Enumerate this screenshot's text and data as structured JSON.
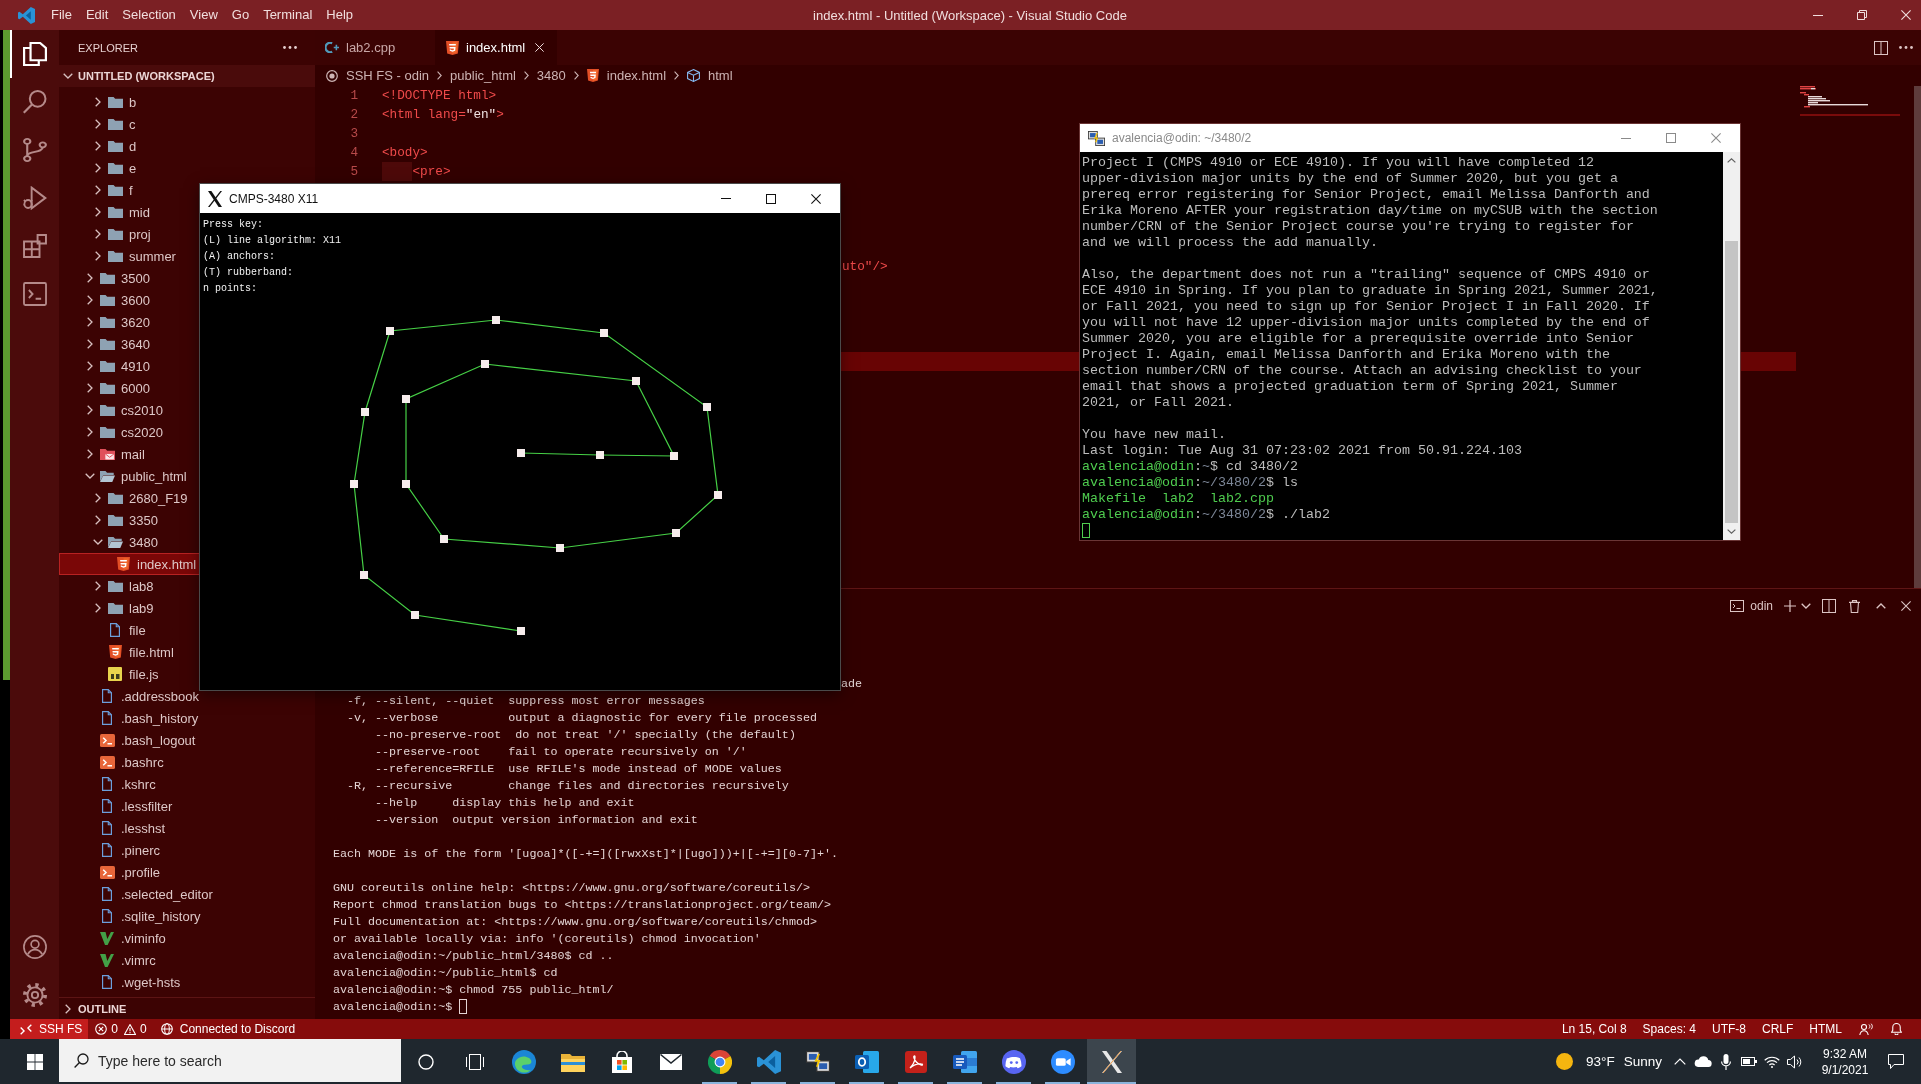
{
  "title_bar": {
    "menus": [
      "File",
      "Edit",
      "Selection",
      "View",
      "Go",
      "Terminal",
      "Help"
    ],
    "title": "index.html - Untitled (Workspace) - Visual Studio Code"
  },
  "activity_bar": {
    "items": [
      {
        "kind": "explorer",
        "selected": true
      },
      {
        "kind": "search",
        "selected": false
      },
      {
        "kind": "source-control",
        "selected": false
      },
      {
        "kind": "run",
        "selected": false
      },
      {
        "kind": "extensions",
        "selected": false
      },
      {
        "kind": "remote",
        "selected": false
      }
    ],
    "bottom_items": [
      {
        "kind": "account"
      },
      {
        "kind": "settings"
      }
    ]
  },
  "sidebar": {
    "title": "EXPLORER",
    "workspace": {
      "label": "UNTITLED (WORKSPACE)",
      "expanded": true
    },
    "tree": [
      {
        "children": [
          {
            "label": "b",
            "kind": "folder",
            "expanded": false,
            "selected": false
          },
          {
            "label": "c",
            "kind": "folder",
            "expanded": false,
            "selected": false
          },
          {
            "label": "d",
            "kind": "folder",
            "expanded": false,
            "selected": false
          },
          {
            "label": "e",
            "kind": "folder",
            "expanded": false,
            "selected": false
          },
          {
            "label": "f",
            "kind": "folder",
            "expanded": false,
            "selected": false
          },
          {
            "label": "mid",
            "kind": "folder",
            "expanded": false,
            "selected": false
          },
          {
            "label": "proj",
            "kind": "folder",
            "expanded": false,
            "selected": false
          },
          {
            "label": "summer",
            "kind": "folder",
            "expanded": false,
            "selected": false
          }
        ]
      },
      {
        "label": "3500",
        "kind": "folder",
        "expanded": false,
        "selected": false
      },
      {
        "label": "3600",
        "kind": "folder",
        "expanded": false,
        "selected": false
      },
      {
        "label": "3620",
        "kind": "folder",
        "expanded": false,
        "selected": false
      },
      {
        "label": "3640",
        "kind": "folder",
        "expanded": false,
        "selected": false
      },
      {
        "label": "4910",
        "kind": "folder",
        "expanded": false,
        "selected": false
      },
      {
        "label": "6000",
        "kind": "folder",
        "expanded": false,
        "selected": false
      },
      {
        "label": "cs2010",
        "kind": "folder",
        "expanded": false,
        "selected": false
      },
      {
        "label": "cs2020",
        "kind": "folder",
        "expanded": false,
        "selected": false
      },
      {
        "label": "mail",
        "kind": "mail-folder",
        "expanded": false,
        "selected": false
      },
      {
        "label": "public_html",
        "kind": "folder",
        "expanded": true,
        "selected": false,
        "children": [
          {
            "label": "2680_F19",
            "kind": "folder",
            "expanded": false,
            "selected": false
          },
          {
            "label": "3350",
            "kind": "folder",
            "expanded": false,
            "selected": false
          },
          {
            "label": "3480",
            "kind": "folder",
            "expanded": true,
            "selected": false,
            "children": [
              {
                "label": "index.html",
                "kind": "html",
                "selected": true
              }
            ]
          },
          {
            "label": "lab8",
            "kind": "folder",
            "expanded": false,
            "selected": false
          },
          {
            "label": "lab9",
            "kind": "folder",
            "expanded": false,
            "selected": false
          },
          {
            "label": "file",
            "kind": "file",
            "selected": false
          },
          {
            "label": "file.html",
            "kind": "html",
            "selected": false
          },
          {
            "label": "file.js",
            "kind": "js",
            "selected": false
          }
        ]
      },
      {
        "label": ".addressbook",
        "kind": "file",
        "selected": false
      },
      {
        "label": ".bash_history",
        "kind": "file",
        "selected": false
      },
      {
        "label": ".bash_logout",
        "kind": "shell",
        "selected": false
      },
      {
        "label": ".bashrc",
        "kind": "shell",
        "selected": false
      },
      {
        "label": ".kshrc",
        "kind": "file",
        "selected": false
      },
      {
        "label": ".lessfilter",
        "kind": "file",
        "selected": false
      },
      {
        "label": ".lesshst",
        "kind": "file",
        "selected": false
      },
      {
        "label": ".pinerc",
        "kind": "file",
        "selected": false
      },
      {
        "label": ".profile",
        "kind": "shell",
        "selected": false
      },
      {
        "label": ".selected_editor",
        "kind": "file",
        "selected": false
      },
      {
        "label": ".sqlite_history",
        "kind": "file",
        "selected": false
      },
      {
        "label": ".viminfo",
        "kind": "vim",
        "selected": false
      },
      {
        "label": ".vimrc",
        "kind": "vim",
        "selected": false
      },
      {
        "label": ".wget-hsts",
        "kind": "file",
        "selected": false
      }
    ],
    "outline": {
      "label": "OUTLINE",
      "expanded": false
    }
  },
  "editor": {
    "tabs": [
      {
        "label": "lab2.cpp",
        "kind": "cpp",
        "selected": false
      },
      {
        "label": "index.html",
        "kind": "html",
        "selected": true
      }
    ],
    "breadcrumbs": [
      {
        "label": "SSH FS - odin",
        "kind": "remote"
      },
      {
        "label": "public_html",
        "kind": "folder"
      },
      {
        "label": "3480",
        "kind": "folder"
      },
      {
        "label": "index.html",
        "kind": "html"
      },
      {
        "label": "html",
        "kind": "element"
      }
    ],
    "lines": [
      {
        "number": "1",
        "segments": [
          {
            "kind": "tag",
            "text": "<!DOCTYPE html>"
          }
        ]
      },
      {
        "number": "2",
        "segments": [
          {
            "kind": "tag",
            "text": "<html lang="
          },
          {
            "kind": "string",
            "text": "\"en\""
          },
          {
            "kind": "tag",
            "text": ">"
          }
        ]
      },
      {
        "number": "3"
      },
      {
        "number": "4",
        "segments": [
          {
            "kind": "tag",
            "text": "<body>"
          }
        ]
      },
      {
        "number": "5",
        "indented": true,
        "segments": [
          {
            "kind": "tag",
            "text": "<pre>"
          }
        ]
      }
    ],
    "covered_fragments": [
      {
        "segments": [
          {
            "kind": "tag",
            "text": "uto\"/>"
          }
        ]
      }
    ],
    "current_line_highlight": true
  },
  "panel": {
    "terminal_name": "odin",
    "lines": [
      {
        "kind": "covered",
        "text": "ade"
      },
      {
        "kind": "text",
        "text": "  -f, --silent, --quiet  suppress most error messages"
      },
      {
        "kind": "text",
        "text": "  -v, --verbose          output a diagnostic for every file processed"
      },
      {
        "kind": "text",
        "text": "      --no-preserve-root  do not treat '/' specially (the default)"
      },
      {
        "kind": "text",
        "text": "      --preserve-root    fail to operate recursively on '/'"
      },
      {
        "kind": "text",
        "text": "      --reference=RFILE  use RFILE's mode instead of MODE values"
      },
      {
        "kind": "text",
        "text": "  -R, --recursive        change files and directories recursively"
      },
      {
        "kind": "text",
        "text": "      --help     display this help and exit"
      },
      {
        "kind": "text",
        "text": "      --version  output version information and exit"
      },
      {
        "kind": "blank"
      },
      {
        "kind": "text",
        "text": "Each MODE is of the form '[ugoa]*([-+=]([rwxXst]*|[ugo]))+|[-+=][0-7]+'."
      },
      {
        "kind": "blank"
      },
      {
        "kind": "text",
        "text": "GNU coreutils online help: <https://www.gnu.org/software/coreutils/>"
      },
      {
        "kind": "text",
        "text": "Report chmod translation bugs to <https://translationproject.org/team/>"
      },
      {
        "kind": "text",
        "text": "Full documentation at: <https://www.gnu.org/software/coreutils/chmod>"
      },
      {
        "kind": "text",
        "text": "or available locally via: info '(coreutils) chmod invocation'"
      },
      {
        "kind": "text",
        "text": "avalencia@odin:~/public_html/3480$ cd .."
      },
      {
        "kind": "text",
        "text": "avalencia@odin:~/public_html$ cd"
      },
      {
        "kind": "text",
        "text": "avalencia@odin:~$ chmod 755 public_html/"
      },
      {
        "kind": "cursor",
        "text": "avalencia@odin:~$"
      }
    ]
  },
  "status_bar": {
    "remote": "SSH FS",
    "errors": "0",
    "warnings": "0",
    "discord": "Connected to Discord",
    "items": [
      "Ln 15, Col 8",
      "Spaces: 4",
      "UTF-8",
      "CRLF",
      "HTML"
    ]
  },
  "x11_window": {
    "title": "CMPS-3480 X11",
    "active": true,
    "lines": [
      "Press key:",
      "(L) line algorithm: X11",
      "(A) anchors:",
      "(T) rubberband:",
      "n points:"
    ]
  },
  "putty_window": {
    "title": "avalencia@odin: ~/3480/2",
    "active": false,
    "lines": [
      {
        "kind": "text",
        "text": "Project I (CMPS 4910 or ECE 4910). If you will have completed 12"
      },
      {
        "kind": "text",
        "text": "upper-division major units by the end of Summer 2020, but you get a"
      },
      {
        "kind": "text",
        "text": "prereq error registering for Senior Project, email Melissa Danforth and"
      },
      {
        "kind": "text",
        "text": "Erika Moreno AFTER your registration day/time on myCSUB with the section"
      },
      {
        "kind": "text",
        "text": "number/CRN of the Senior Project course you're trying to register for"
      },
      {
        "kind": "text",
        "text": "and we will process the add manually."
      },
      {
        "kind": "blank"
      },
      {
        "kind": "text",
        "text": "Also, the department does not run a \"trailing\" sequence of CMPS 4910 or"
      },
      {
        "kind": "text",
        "text": "ECE 4910 in Spring. If you plan to graduate in Spring 2021, Summer 2021,"
      },
      {
        "kind": "text",
        "text": "or Fall 2021, you need to sign up for Senior Project I in Fall 2020. If"
      },
      {
        "kind": "text",
        "text": "you will not have 12 upper-division major units completed by the end of"
      },
      {
        "kind": "text",
        "text": "Summer 2020, you are eligible for a prerequisite override into Senior"
      },
      {
        "kind": "text",
        "text": "Project I. Again, email Melissa Danforth and Erika Moreno with the"
      },
      {
        "kind": "text",
        "text": "section number/CRN of the course. Attach an advising checklist to your"
      },
      {
        "kind": "text",
        "text": "email that shows a projected graduation term of Spring 2021, Summer"
      },
      {
        "kind": "text",
        "text": "2021, or Fall 2021."
      },
      {
        "kind": "blank"
      },
      {
        "kind": "text",
        "text": "You have new mail."
      },
      {
        "kind": "text",
        "text": "Last login: Tue Aug 31 07:23:02 2021 from 50.91.224.103"
      },
      {
        "kind": "prompt",
        "segments": [
          {
            "kind": "user",
            "text": "avalencia@odin"
          },
          {
            "kind": "plain",
            "text": ":"
          },
          {
            "kind": "path",
            "text": "~"
          },
          {
            "kind": "plain",
            "text": "$ cd 3480/2"
          }
        ]
      },
      {
        "kind": "prompt",
        "segments": [
          {
            "kind": "user",
            "text": "avalencia@odin"
          },
          {
            "kind": "plain",
            "text": ":"
          },
          {
            "kind": "path",
            "text": "~/3480/2"
          },
          {
            "kind": "plain",
            "text": "$ ls"
          }
        ]
      },
      {
        "kind": "listing",
        "text": "Makefile  lab2  lab2.cpp"
      },
      {
        "kind": "prompt",
        "segments": [
          {
            "kind": "user",
            "text": "avalencia@odin"
          },
          {
            "kind": "plain",
            "text": ":"
          },
          {
            "kind": "path",
            "text": "~/3480/2"
          },
          {
            "kind": "plain",
            "text": "$ ./lab2"
          }
        ]
      },
      {
        "kind": "cursor"
      }
    ]
  },
  "taskbar": {
    "search": {
      "placeholder": "Type here to search"
    },
    "buttons": [
      {
        "kind": "swirl",
        "running": false,
        "selected": false
      },
      {
        "kind": "folder",
        "running": false,
        "selected": false
      },
      {
        "kind": "bag",
        "running": false,
        "selected": false
      },
      {
        "kind": "envelope",
        "running": false,
        "selected": false
      },
      {
        "kind": "wheel",
        "running": true,
        "selected": false
      },
      {
        "kind": "ribbon",
        "running": true,
        "selected": false
      },
      {
        "kind": "computers",
        "running": true,
        "selected": false
      },
      {
        "kind": "ring-tile",
        "running": true,
        "selected": false
      },
      {
        "kind": "curl-tile",
        "running": true,
        "selected": false
      },
      {
        "kind": "doc-tile",
        "running": true,
        "selected": false
      },
      {
        "kind": "face",
        "running": true,
        "selected": false
      },
      {
        "kind": "camera",
        "running": true,
        "selected": false
      },
      {
        "kind": "cross",
        "running": true,
        "selected": true
      }
    ],
    "weather": {
      "temperature": "93°F",
      "condition": "Sunny"
    },
    "clock": {
      "time": "9:32 AM",
      "date": "9/1/2021"
    }
  }
}
